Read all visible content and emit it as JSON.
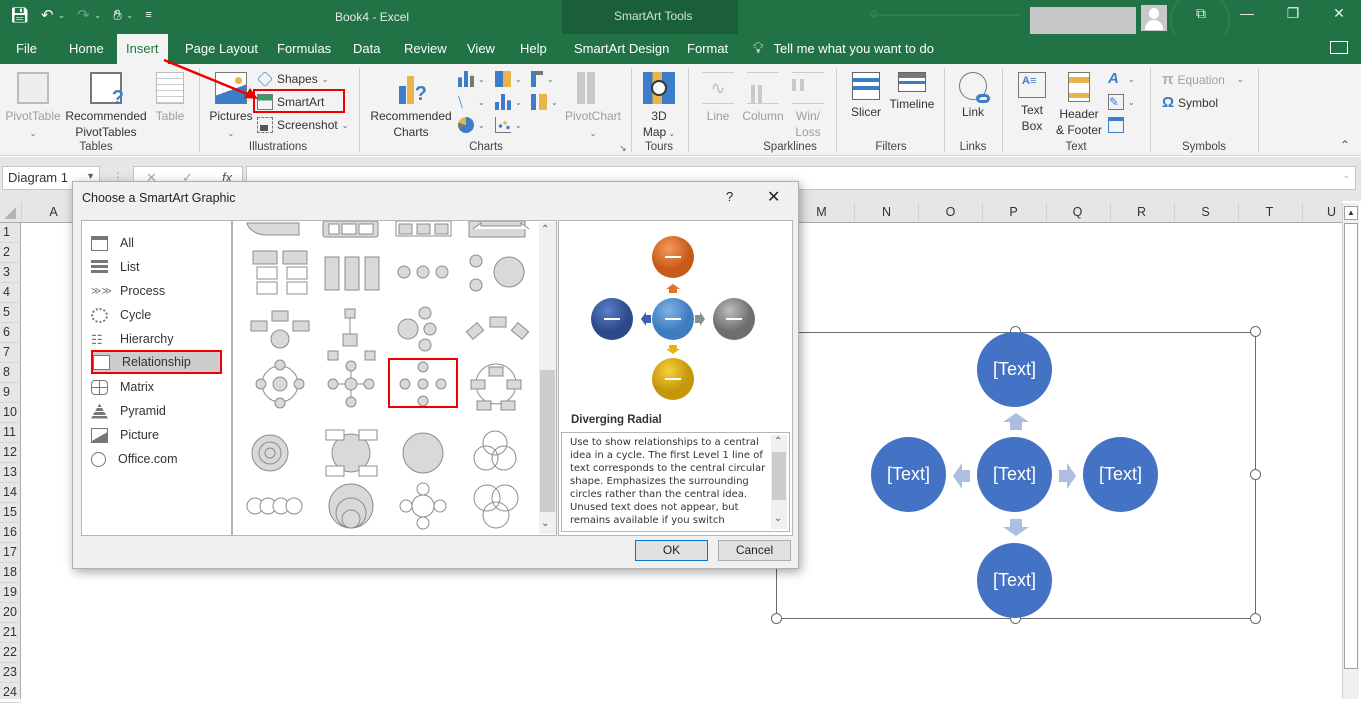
{
  "titlebar": {
    "document_title": "Book4  -  Excel",
    "contextual_tools_title": "SmartArt Tools",
    "qat": {
      "save_icon": "save-icon",
      "undo_icon": "undo-icon",
      "redo_icon": "redo-icon",
      "touch_icon": "touch-mode-icon",
      "customize_icon": "customize-qat-icon"
    },
    "window_buttons": {
      "ribbon_display": "⧉",
      "minimize": "—",
      "restore": "❐",
      "close": "✕"
    }
  },
  "tabs": [
    {
      "label": "File"
    },
    {
      "label": "Home"
    },
    {
      "label": "Insert",
      "active": true
    },
    {
      "label": "Page Layout"
    },
    {
      "label": "Formulas"
    },
    {
      "label": "Data"
    },
    {
      "label": "Review"
    },
    {
      "label": "View"
    },
    {
      "label": "Help"
    },
    {
      "label": "SmartArt Design"
    },
    {
      "label": "Format"
    }
  ],
  "tell_me": "Tell me what you want to do",
  "ribbon": {
    "tables": {
      "label": "Tables",
      "pivottable": "PivotTable",
      "recommended_pivottables_1": "Recommended",
      "recommended_pivottables_2": "PivotTables",
      "table": "Table"
    },
    "illustrations": {
      "label": "Illustrations",
      "pictures": "Pictures",
      "shapes": "Shapes",
      "smartart": "SmartArt",
      "screenshot": "Screenshot"
    },
    "charts": {
      "label": "Charts",
      "recommended_charts_1": "Recommended",
      "recommended_charts_2": "Charts",
      "pivotchart": "PivotChart"
    },
    "tours": {
      "label": "Tours",
      "map_1": "3D",
      "map_2": "Map"
    },
    "sparklines": {
      "label": "Sparklines",
      "line": "Line",
      "column": "Column",
      "winloss_1": "Win/",
      "winloss_2": "Loss"
    },
    "filters": {
      "label": "Filters",
      "slicer": "Slicer",
      "timeline": "Timeline"
    },
    "links": {
      "label": "Links",
      "link": "Link"
    },
    "text": {
      "label": "Text",
      "textbox_1": "Text",
      "textbox_2": "Box",
      "header_footer_1": "Header",
      "header_footer_2": "& Footer"
    },
    "symbols": {
      "label": "Symbols",
      "equation": "Equation",
      "symbol": "Symbol",
      "pi_glyph": "π",
      "omega_glyph": "Ω"
    }
  },
  "formula_bar": {
    "name_box": "Diagram 1",
    "cancel": "✕",
    "enter": "✓",
    "fx": "fx",
    "formula": ""
  },
  "columns": [
    "A",
    "M",
    "N",
    "O",
    "P",
    "Q",
    "R",
    "S",
    "T",
    "U"
  ],
  "rows": [
    "1",
    "2",
    "3",
    "4",
    "5",
    "6",
    "7",
    "8",
    "9",
    "10",
    "11",
    "12",
    "13",
    "14",
    "15",
    "16",
    "17",
    "18",
    "19",
    "20",
    "21",
    "22",
    "23",
    "24"
  ],
  "smartart_on_sheet": {
    "layout": "Diverging Radial",
    "nodes": [
      {
        "position": "center",
        "text": "[Text]"
      },
      {
        "position": "top",
        "text": "[Text]"
      },
      {
        "position": "left",
        "text": "[Text]"
      },
      {
        "position": "right",
        "text": "[Text]"
      },
      {
        "position": "bottom",
        "text": "[Text]"
      }
    ],
    "fill_color": "#4472c4",
    "arrow_color": "#adbfe0"
  },
  "dialog": {
    "title": "Choose a SmartArt Graphic",
    "help": "?",
    "close": "✕",
    "categories": [
      {
        "label": "All",
        "icon": "all-icon"
      },
      {
        "label": "List",
        "icon": "list-icon"
      },
      {
        "label": "Process",
        "icon": "process-icon"
      },
      {
        "label": "Cycle",
        "icon": "cycle-icon"
      },
      {
        "label": "Hierarchy",
        "icon": "hierarchy-icon"
      },
      {
        "label": "Relationship",
        "icon": "relationship-icon",
        "selected": true
      },
      {
        "label": "Matrix",
        "icon": "matrix-icon"
      },
      {
        "label": "Pyramid",
        "icon": "pyramid-icon"
      },
      {
        "label": "Picture",
        "icon": "picture-icon"
      },
      {
        "label": "Office.com",
        "icon": "globe-icon"
      }
    ],
    "gallery_selected": "Diverging Radial",
    "preview": {
      "name": "Diverging Radial",
      "description": "Use to show relationships to a central idea in a cycle. The first Level 1 line of text corresponds to the central circular shape. Emphasizes the surrounding circles rather than the central idea. Unused text does not appear, but remains available if you switch",
      "colors": {
        "top": "#e2732b",
        "left": "#3e60a8",
        "center": "#5b9bd5",
        "right": "#8c8c8c",
        "bottom": "#e6b314"
      }
    },
    "ok": "OK",
    "cancel": "Cancel"
  }
}
